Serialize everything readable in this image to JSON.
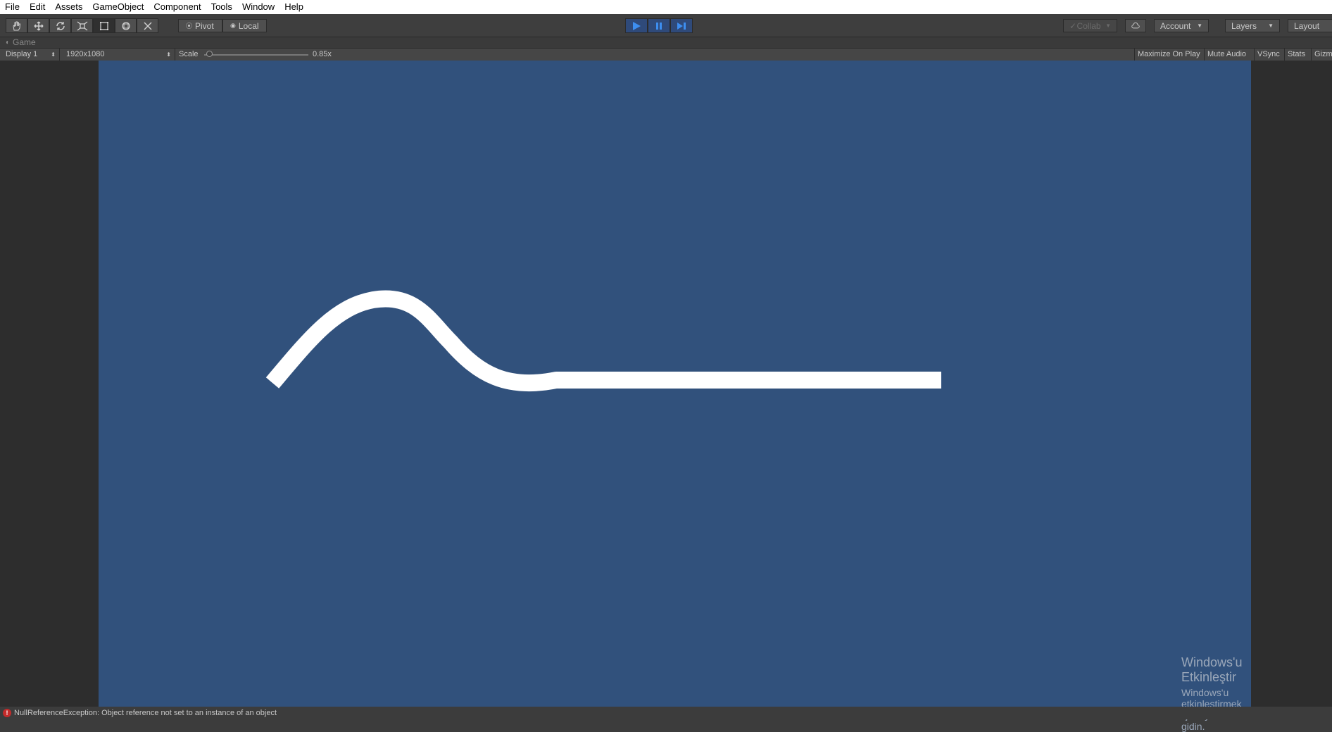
{
  "menu": [
    "File",
    "Edit",
    "Assets",
    "GameObject",
    "Component",
    "Tools",
    "Window",
    "Help"
  ],
  "toolbar": {
    "pivot_label": "Pivot",
    "local_label": "Local",
    "collab_label": "Collab",
    "account_label": "Account",
    "layers_label": "Layers",
    "layout_label": "Layout"
  },
  "game_panel": {
    "tab_label": "Game",
    "display_label": "Display 1",
    "resolution_label": "1920x1080",
    "scale_label": "Scale",
    "scale_value_label": "0.85x",
    "scale_level": 0.05,
    "maximize_label": "Maximize On Play",
    "mute_label": "Mute Audio",
    "vsync_label": "VSync",
    "stats_label": "Stats",
    "gizmos_label": "Gizmos"
  },
  "scene": {
    "background_color": "#31517c",
    "line_color": "#ffffff"
  },
  "watermark": {
    "title": "Windows'u Etkinleştir",
    "subtitle": "Windows'u etkinleştirmek için Ayarlar'a gidin."
  },
  "status": {
    "message": "NullReferenceException: Object reference not set to an instance of an object"
  },
  "colors": {
    "play_accent": "#3d8ef0",
    "error": "#c42b2b"
  }
}
